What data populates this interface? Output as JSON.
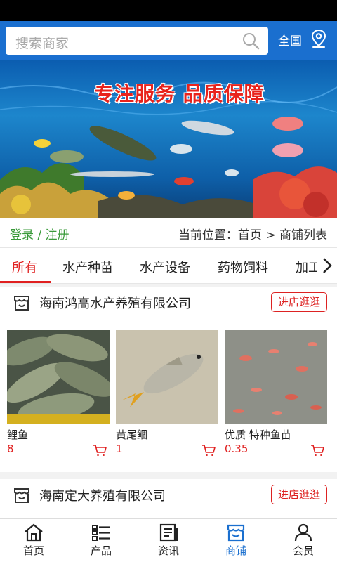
{
  "search": {
    "placeholder": "搜索商家"
  },
  "header": {
    "region": "全国"
  },
  "banner": {
    "slogan": "专注服务  品质保障"
  },
  "infobar": {
    "login": "登录",
    "sep": "/",
    "register": "注册",
    "breadcrumb": "当前位置：首页 > 商铺列表"
  },
  "tabs": [
    "所有",
    "水产种苗",
    "水产设备",
    "药物饲料",
    "加工"
  ],
  "shops": [
    {
      "name": "海南鸿高水产养殖有限公司",
      "button": "进店逛逛",
      "products": [
        {
          "name": "鲤鱼",
          "price": "8"
        },
        {
          "name": "黄尾鲴",
          "price": "1"
        },
        {
          "name": "优质 特种鱼苗",
          "price": "0.35"
        }
      ]
    },
    {
      "name": "海南定大养殖有限公司",
      "button": "进店逛逛"
    }
  ],
  "nav": [
    {
      "label": "首页",
      "icon": "home-icon"
    },
    {
      "label": "产品",
      "icon": "list-icon"
    },
    {
      "label": "资讯",
      "icon": "news-icon"
    },
    {
      "label": "商铺",
      "icon": "store-icon",
      "active": true
    },
    {
      "label": "会员",
      "icon": "user-icon"
    }
  ],
  "colors": {
    "primary": "#1a6fcf",
    "accent": "#e02020",
    "login": "#3a9a3a"
  }
}
